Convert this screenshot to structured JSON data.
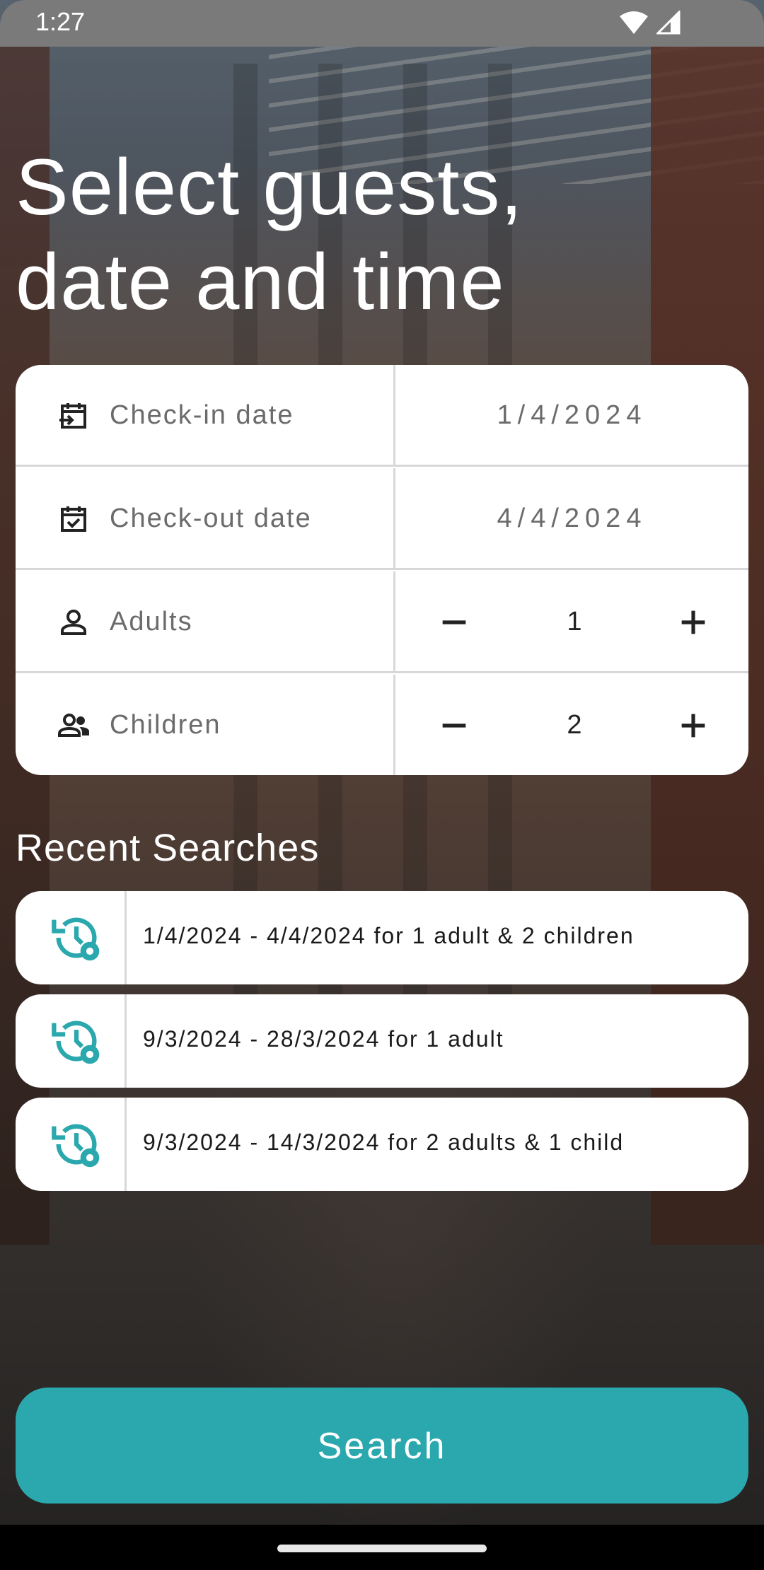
{
  "status_bar": {
    "time": "1:27"
  },
  "headline": {
    "line1": "Select guests,",
    "line2": "date and time"
  },
  "form": {
    "check_in": {
      "label": "Check-in date",
      "value": "1/4/2024",
      "icon": "calendar-arrow-icon"
    },
    "check_out": {
      "label": "Check-out date",
      "value": "4/4/2024",
      "icon": "calendar-check-icon"
    },
    "adults": {
      "label": "Adults",
      "value": "1",
      "icon": "person-icon"
    },
    "children": {
      "label": "Children",
      "value": "2",
      "icon": "people-icon"
    }
  },
  "recent": {
    "title": "Recent Searches",
    "items": [
      {
        "text": "1/4/2024 - 4/4/2024 for 1 adult & 2 children"
      },
      {
        "text": "9/3/2024 - 28/3/2024 for 1 adult"
      },
      {
        "text": "9/3/2024 - 14/3/2024 for 2 adults & 1 child"
      }
    ]
  },
  "search_button": {
    "label": "Search"
  },
  "colors": {
    "accent": "#2aa8ad",
    "label_gray": "#6b6b6b"
  }
}
